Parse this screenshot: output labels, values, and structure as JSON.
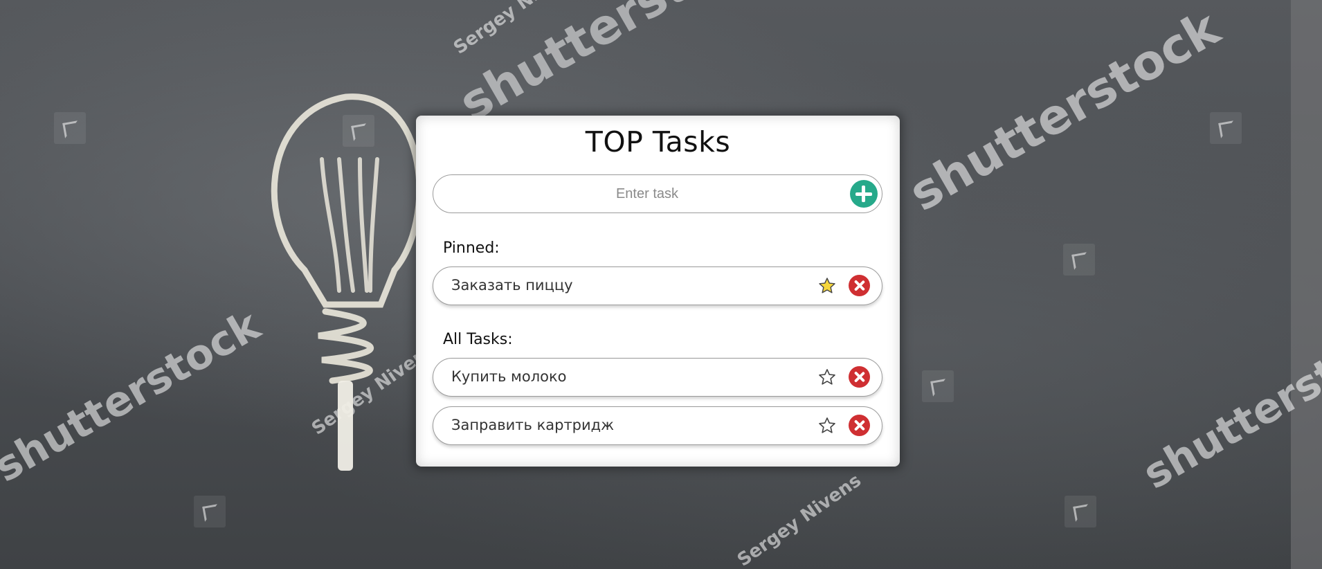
{
  "background": {
    "watermarks": [
      "shutterstock",
      "Sergey Nivens"
    ]
  },
  "app": {
    "title": "TOP Tasks"
  },
  "input": {
    "placeholder": "Enter task",
    "value": ""
  },
  "sections": {
    "pinned_label": "Pinned:",
    "all_label": "All Tasks:"
  },
  "pinned_tasks": [
    {
      "text": "Заказать пиццу",
      "pinned": true
    }
  ],
  "all_tasks": [
    {
      "text": "Купить молоко",
      "pinned": false
    },
    {
      "text": "Заправить картридж",
      "pinned": false
    }
  ],
  "colors": {
    "add_button": "#26a98a",
    "delete_button": "#cf2f32",
    "star_pinned_fill": "#f5d63c",
    "star_outline": "#444444"
  },
  "icons": {
    "add": "plus-circle-icon",
    "pin": "star-icon",
    "delete": "close-circle-icon"
  }
}
